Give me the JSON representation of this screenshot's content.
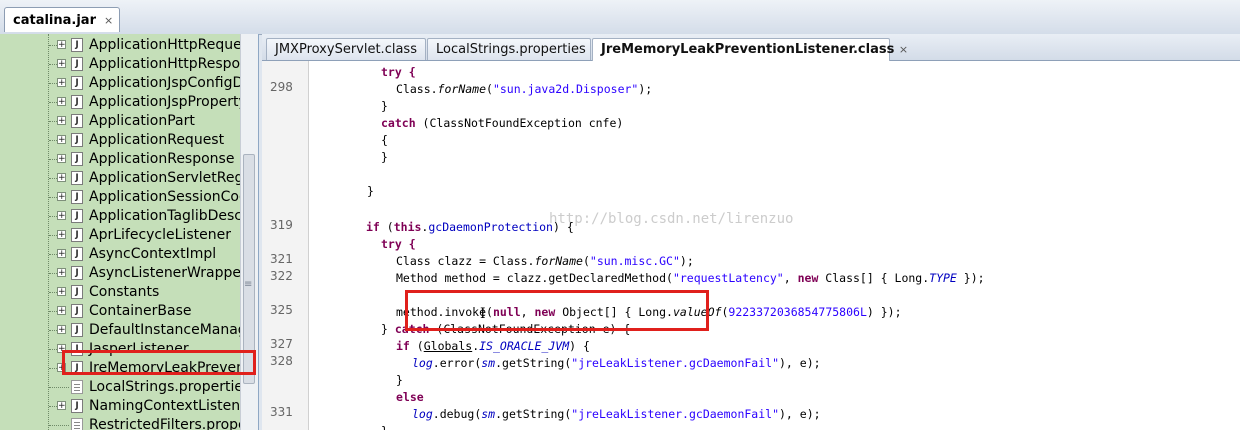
{
  "window": {
    "tab_title": "catalina.jar",
    "close_glyph": "×"
  },
  "sidebar": {
    "items": [
      {
        "label": "ApplicationHttpRequest",
        "type": "class",
        "expandable": true
      },
      {
        "label": "ApplicationHttpResponse",
        "type": "class",
        "expandable": true
      },
      {
        "label": "ApplicationJspConfigDescriptor",
        "type": "class",
        "expandable": true
      },
      {
        "label": "ApplicationJspPropertyGroupDescriptor",
        "type": "class",
        "expandable": true
      },
      {
        "label": "ApplicationPart",
        "type": "class",
        "expandable": true
      },
      {
        "label": "ApplicationRequest",
        "type": "class",
        "expandable": true
      },
      {
        "label": "ApplicationResponse",
        "type": "class",
        "expandable": true
      },
      {
        "label": "ApplicationServletRegistration",
        "type": "class",
        "expandable": true
      },
      {
        "label": "ApplicationSessionCookieConfig",
        "type": "class",
        "expandable": true
      },
      {
        "label": "ApplicationTaglibDescriptor",
        "type": "class",
        "expandable": true
      },
      {
        "label": "AprLifecycleListener",
        "type": "class",
        "expandable": true
      },
      {
        "label": "AsyncContextImpl",
        "type": "class",
        "expandable": true
      },
      {
        "label": "AsyncListenerWrapper",
        "type": "class",
        "expandable": true
      },
      {
        "label": "Constants",
        "type": "class",
        "expandable": true
      },
      {
        "label": "ContainerBase",
        "type": "class",
        "expandable": true
      },
      {
        "label": "DefaultInstanceManager",
        "type": "class",
        "expandable": true
      },
      {
        "label": "JasperListener",
        "type": "class",
        "expandable": true
      },
      {
        "label": "JreMemoryLeakPreventionListener",
        "type": "class",
        "expandable": true,
        "highlighted": true
      },
      {
        "label": "LocalStrings.properties",
        "type": "properties",
        "expandable": false
      },
      {
        "label": "NamingContextListener",
        "type": "class",
        "expandable": true
      },
      {
        "label": "RestrictedFilters.properties",
        "type": "properties",
        "expandable": false
      }
    ],
    "grip_glyph": "≡"
  },
  "editor": {
    "tabs": [
      {
        "label": "JMXProxyServlet.class",
        "active": false
      },
      {
        "label": "LocalStrings.properties",
        "active": false
      },
      {
        "label": "JreMemoryLeakPreventionListener.class",
        "active": true,
        "close_glyph": "×"
      }
    ],
    "watermark": "http://blog.csdn.net/lirenzuo",
    "line_numbers": [
      "298",
      "319",
      "321",
      "322",
      "325",
      "327",
      "328",
      "331"
    ],
    "code": {
      "l1": "try {",
      "l2a": "Class.",
      "l2b": "forName",
      "l2c": "(",
      "l2d": "\"sun.java2d.Disposer\"",
      "l2e": ");",
      "l3": "}",
      "l4a": "catch",
      "l4b": " (ClassNotFoundException cnfe)",
      "l5": "{",
      "l6": "}",
      "l7": "}",
      "l8a": "if",
      "l8b": " (",
      "l8c": "this",
      "l8d": ".",
      "l8e": "gcDaemonProtection",
      "l8f": ") {",
      "l9": "try {",
      "l10a": "Class clazz = Class.",
      "l10b": "forName",
      "l10c": "(",
      "l10d": "\"sun.misc.GC\"",
      "l10e": ");",
      "l11a": "Method method = clazz.getDeclaredMethod(",
      "l11b": "\"requestLatency\"",
      "l11c": ", ",
      "l11d": "new",
      "l11e": " Class[] { Long.",
      "l11f": "TYPE",
      "l11g": " });",
      "l12a": "method.invoke(",
      "l12b": "null",
      "l12c": ", ",
      "l12d": "new",
      "l12e": " Object[] { Long.",
      "l12f": "valueOf",
      "l12g": "(",
      "l12h": "9223372036854775806L",
      "l12i": ") });",
      "l13a": "} ",
      "l13b": "catch",
      "l13c": " (ClassNotFoundException e) {",
      "l14a": "if",
      "l14b": " (",
      "l14c": "Globals",
      "l14d": ".",
      "l14e": "IS_ORACLE_JVM",
      "l14f": ") {",
      "l15a": "log",
      "l15b": ".error(",
      "l15c": "sm",
      "l15d": ".getString(",
      "l15e": "\"jreLeakListener.gcDaemonFail\"",
      "l15f": "), e);",
      "l16": "}",
      "l17": "else",
      "l18a": "log",
      "l18b": ".debug(",
      "l18c": "sm",
      "l18d": ".getString(",
      "l18e": "\"jreLeakListener.gcDaemonFail\"",
      "l18f": "), e);",
      "l19": "}"
    },
    "cursor_glyph": "I"
  }
}
